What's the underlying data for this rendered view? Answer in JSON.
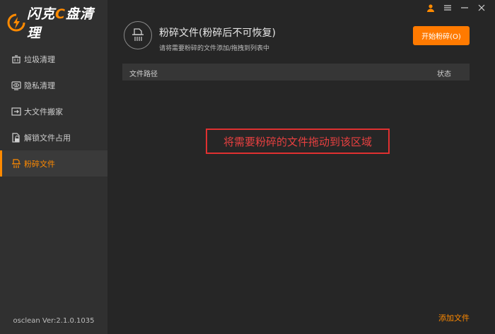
{
  "app": {
    "logo_prefix": "闪克",
    "logo_accent": "C",
    "logo_suffix": "盘清理",
    "version": "osclean Ver:2.1.0.1035"
  },
  "sidebar": {
    "items": [
      {
        "label": "垃圾清理",
        "icon": "trash-icon"
      },
      {
        "label": "隐私清理",
        "icon": "eye-icon"
      },
      {
        "label": "大文件搬家",
        "icon": "move-file-icon"
      },
      {
        "label": "解锁文件占用",
        "icon": "unlock-file-icon"
      },
      {
        "label": "粉碎文件",
        "icon": "shred-icon",
        "active": true
      }
    ]
  },
  "header": {
    "title": "粉碎文件(粉碎后不可恢复)",
    "subtitle": "请将需要粉碎的文件添加/拖拽到列表中",
    "start_button": "开始粉碎(O)"
  },
  "table": {
    "col_path": "文件路径",
    "col_status": "状态"
  },
  "drop_hint": "将需要粉碎的文件拖动到该区域",
  "footer": {
    "add_file": "添加文件"
  },
  "colors": {
    "accent": "#ff7a00",
    "hint_red": "#e03030",
    "sidebar_bg": "#303030",
    "main_bg": "#262626"
  }
}
